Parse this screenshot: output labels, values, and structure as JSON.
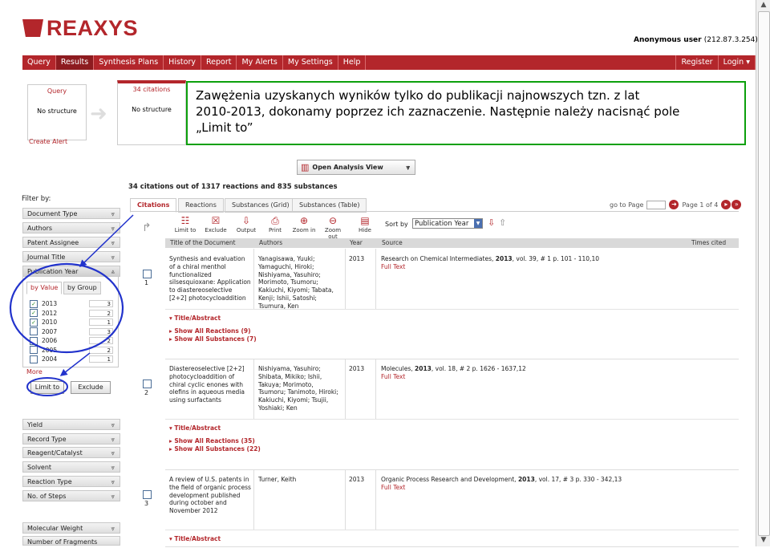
{
  "header": {
    "logo_text": "REAXYS",
    "user_label": "Anonymous user",
    "user_ip": "(212.87.3.254)"
  },
  "nav": {
    "left": [
      "Query",
      "Results",
      "Synthesis Plans",
      "History",
      "Report",
      "My Alerts",
      "My Settings",
      "Help"
    ],
    "right": [
      "Register",
      "Login ▾"
    ],
    "active": "Results"
  },
  "workflow": {
    "query_title": "Query",
    "query_text": "No structure",
    "create_alert": "Create Alert",
    "citations_title": "34 citations",
    "citations_text": "No structure"
  },
  "annotation": {
    "line1": "Zawężenia uzyskanych wyników tylko do publikacji najnowszych tzn. z lat",
    "line2": "2010-2013, dokonamy poprzez ich zaznaczenie. Następnie należy nacisnąć pole",
    "line3": "„Limit to”"
  },
  "analysis_button": "Open Analysis View",
  "filters": {
    "label": "Filter by:",
    "top_facets": [
      "Document Type",
      "Authors",
      "Patent Assignee",
      "Journal Title",
      "Publication Year"
    ],
    "pub_tabs": [
      "by Value",
      "by Group"
    ],
    "years": [
      {
        "year": "2013",
        "count": "3",
        "checked": true
      },
      {
        "year": "2012",
        "count": "2",
        "checked": true
      },
      {
        "year": "2010",
        "count": "1",
        "checked": true
      },
      {
        "year": "2007",
        "count": "3",
        "checked": false
      },
      {
        "year": "2006",
        "count": "2",
        "checked": false
      },
      {
        "year": "2005",
        "count": "2",
        "checked": false
      },
      {
        "year": "2004",
        "count": "1",
        "checked": false
      }
    ],
    "more": "More",
    "limit_to": "Limit to",
    "exclude": "Exclude",
    "bottom_facets": [
      "Yield",
      "Record Type",
      "Reagent/Catalyst",
      "Solvent",
      "Reaction Type",
      "No. of Steps",
      "Molecular Weight",
      "Number of Fragments"
    ]
  },
  "results": {
    "summary": "34 citations out of 1317 reactions and 835 substances",
    "tabs": [
      "Citations",
      "Reactions",
      "Substances (Grid)",
      "Substances (Table)"
    ],
    "go_to_page": "go to Page",
    "page_info": "Page 1 of 4",
    "toolbar": [
      "Limit to",
      "Exclude",
      "Output",
      "Print",
      "Zoom in",
      "Zoom out",
      "Hide"
    ],
    "sort_by": "Sort by",
    "sort_value": "Publication Year",
    "columns": [
      "Title of the Document",
      "Authors",
      "Year",
      "Source",
      "Times cited"
    ],
    "rows": [
      {
        "num": "1",
        "title": "Synthesis and evaluation of a chiral menthol functionalized silsesquioxane: Application to diastereoselective [2+2] photocycloaddition",
        "authors": "Yanagisawa, Yuuki; Yamaguchi, Hiroki; Nishiyama, Yasuhiro; Morimoto, Tsumoru; Kakiuchi, Kiyomi; Tabata, Kenji; Ishii, Satoshi; Tsumura, Ken",
        "year": "2013",
        "source_a": "Research on Chemical Intermediates,",
        "source_year": "2013",
        "source_b": ", vol. 39, # 1  p. 101 - 110,10",
        "fulltext": "Full Text",
        "links": [
          "Title/Abstract",
          "Show All Reactions (9)",
          "Show All Substances (7)"
        ]
      },
      {
        "num": "2",
        "title": "Diastereoselective [2+2] photocycloaddition of chiral cyclic enones with olefins in aqueous media using surfactants",
        "authors": "Nishiyama, Yasuhiro; Shibata, Mikiko; Ishii, Takuya; Morimoto, Tsumoru; Tanimoto, Hiroki; Kakiuchi, Kiyomi; Tsujii, Yoshiaki; Ken",
        "year": "2013",
        "source_a": "Molecules,",
        "source_year": "2013",
        "source_b": ", vol. 18, # 2  p. 1626 - 1637,12",
        "fulltext": "Full Text",
        "links": [
          "Title/Abstract",
          "Show All Reactions (35)",
          "Show All Substances (22)"
        ]
      },
      {
        "num": "3",
        "title": "A review of U.S. patents in the field of organic process development published during october and November 2012",
        "authors": "Turner, Keith",
        "year": "2013",
        "source_a": "Organic Process Research and Development,",
        "source_year": "2013",
        "source_b": ", vol. 17, # 3  p. 330 - 342,13",
        "fulltext": "Full Text",
        "links": [
          "Title/Abstract"
        ]
      }
    ]
  },
  "colors": {
    "brand": "#b3262b",
    "annotation_border": "#0ca00c",
    "annotation_arrow": "#2233cc"
  }
}
